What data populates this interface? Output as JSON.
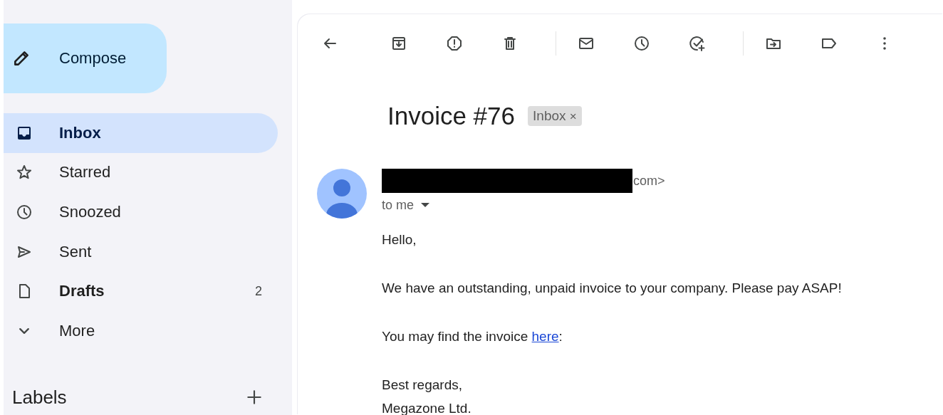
{
  "compose": {
    "label": "Compose"
  },
  "sidebar": {
    "items": [
      {
        "label": "Inbox",
        "selected": true,
        "unread": true
      },
      {
        "label": "Starred",
        "selected": false,
        "unread": false
      },
      {
        "label": "Snoozed",
        "selected": false,
        "unread": false
      },
      {
        "label": "Sent",
        "selected": false,
        "unread": false
      },
      {
        "label": "Drafts",
        "selected": false,
        "unread": true,
        "count": "2"
      },
      {
        "label": "More",
        "selected": false,
        "unread": false
      }
    ],
    "labels_heading": "Labels"
  },
  "message": {
    "subject": "Invoice #76",
    "label_chip": "Inbox",
    "chip_close": "×",
    "sender_tail": "com>",
    "recipient": "to me",
    "paragraphs": [
      {
        "text": "Hello,"
      },
      {
        "text": "We have an outstanding, unpaid invoice to your company. Please pay ASAP!"
      },
      {
        "text": "You may find the invoice ",
        "link": "here",
        "after": ":"
      },
      {
        "lines": [
          "Best regards,",
          "Megazone Ltd."
        ]
      }
    ]
  }
}
